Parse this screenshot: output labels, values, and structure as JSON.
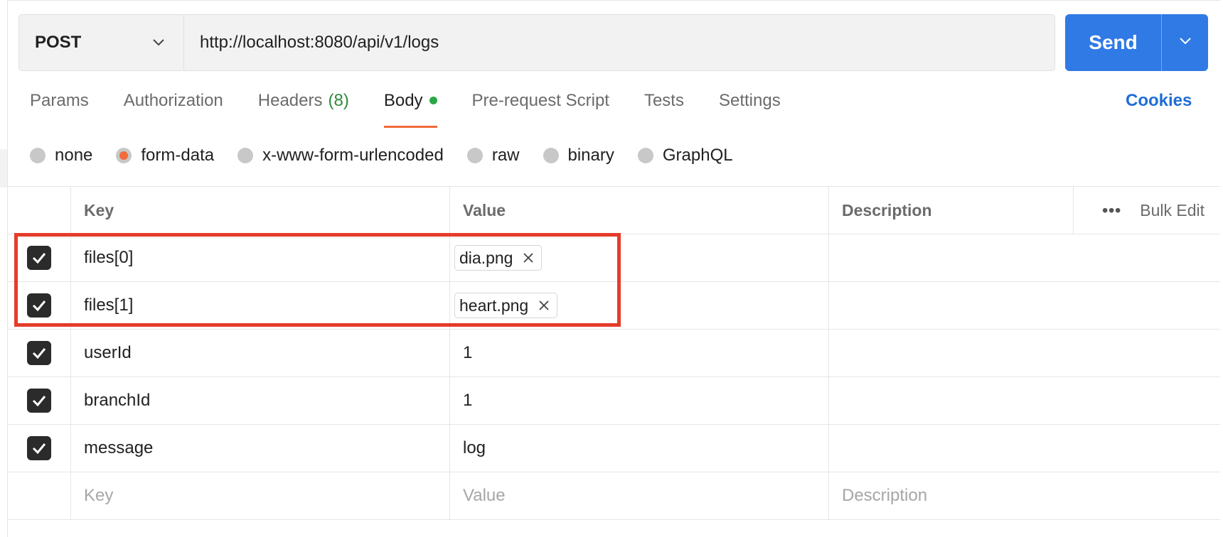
{
  "request": {
    "method": "POST",
    "url": "http://localhost:8080/api/v1/logs",
    "send_label": "Send"
  },
  "tabs": [
    {
      "label": "Params"
    },
    {
      "label": "Authorization"
    },
    {
      "label": "Headers",
      "count": "(8)"
    },
    {
      "label": "Body",
      "active": true
    },
    {
      "label": "Pre-request Script"
    },
    {
      "label": "Tests"
    },
    {
      "label": "Settings"
    }
  ],
  "cookies_label": "Cookies",
  "body_types": [
    {
      "label": "none"
    },
    {
      "label": "form-data",
      "selected": true
    },
    {
      "label": "x-www-form-urlencoded"
    },
    {
      "label": "raw"
    },
    {
      "label": "binary"
    },
    {
      "label": "GraphQL"
    }
  ],
  "table": {
    "headers": {
      "key": "Key",
      "value": "Value",
      "description": "Description",
      "bulk_edit": "Bulk Edit"
    },
    "rows": [
      {
        "checked": true,
        "key": "files[0]",
        "value": "dia.png",
        "value_type": "file"
      },
      {
        "checked": true,
        "key": "files[1]",
        "value": "heart.png",
        "value_type": "file"
      },
      {
        "checked": true,
        "key": "userId",
        "value": "1",
        "value_type": "text"
      },
      {
        "checked": true,
        "key": "branchId",
        "value": "1",
        "value_type": "text"
      },
      {
        "checked": true,
        "key": "message",
        "value": "log",
        "value_type": "text"
      }
    ],
    "placeholders": {
      "key": "Key",
      "value": "Value",
      "description": "Description"
    }
  },
  "colors": {
    "send": "#2f7ae5",
    "active_tab_underline": "#f26b3a",
    "highlight_box": "#e53c2a",
    "cookies_link": "#1f6ed4"
  }
}
